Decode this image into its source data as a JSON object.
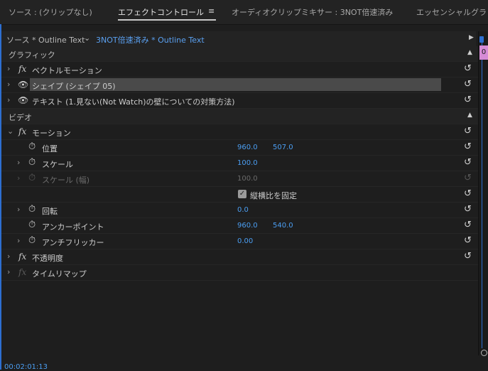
{
  "tabs": {
    "source": "ソース : (クリップなし)",
    "effect_controls": "エフェクトコントロール",
    "menu_icon": "≡",
    "audio_mixer": "オーディオクリップミキサー : 3NOT倍速済み",
    "essential": "エッセンシャルグラ"
  },
  "source_row": {
    "source": "ソース * Outline Text",
    "chevron": "⌄",
    "clip": "3NOT倍速済み * Outline Text"
  },
  "playhead_label": "0",
  "sections": {
    "graphics": "グラフィック",
    "video": "ビデオ"
  },
  "graphics_rows": {
    "vector_motion": "ベクトルモーション",
    "shape": "シェイプ (シェイプ 05)",
    "text": "テキスト (1.見ない(Not Watch)の壁についての対策方法)"
  },
  "motion": {
    "label": "モーション",
    "position": {
      "label": "位置",
      "x": "960.0",
      "y": "507.0"
    },
    "scale": {
      "label": "スケール",
      "value": "100.0"
    },
    "scale_width": {
      "label": "スケール (幅)",
      "value": "100.0"
    },
    "uniform_scale": {
      "label": "縦横比を固定",
      "checked": true
    },
    "rotation": {
      "label": "回転",
      "value": "0.0"
    },
    "anchor": {
      "label": "アンカーポイント",
      "x": "960.0",
      "y": "540.0"
    },
    "anti_flicker": {
      "label": "アンチフリッカー",
      "value": "0.00"
    }
  },
  "opacity": "不透明度",
  "time_remap": "タイムリマップ",
  "timecode": "00:02:01:13",
  "icons": {
    "fx": "fx",
    "eye": "👁",
    "stopwatch": "⏱",
    "reset": "↺",
    "chev_right": "›",
    "chev_down": "⌄",
    "up": "▲",
    "play": "▶",
    "check": "✓"
  },
  "colors": {
    "accent": "#2d6fd1",
    "value": "#4b9ef2",
    "playhead": "#d68bd6"
  }
}
